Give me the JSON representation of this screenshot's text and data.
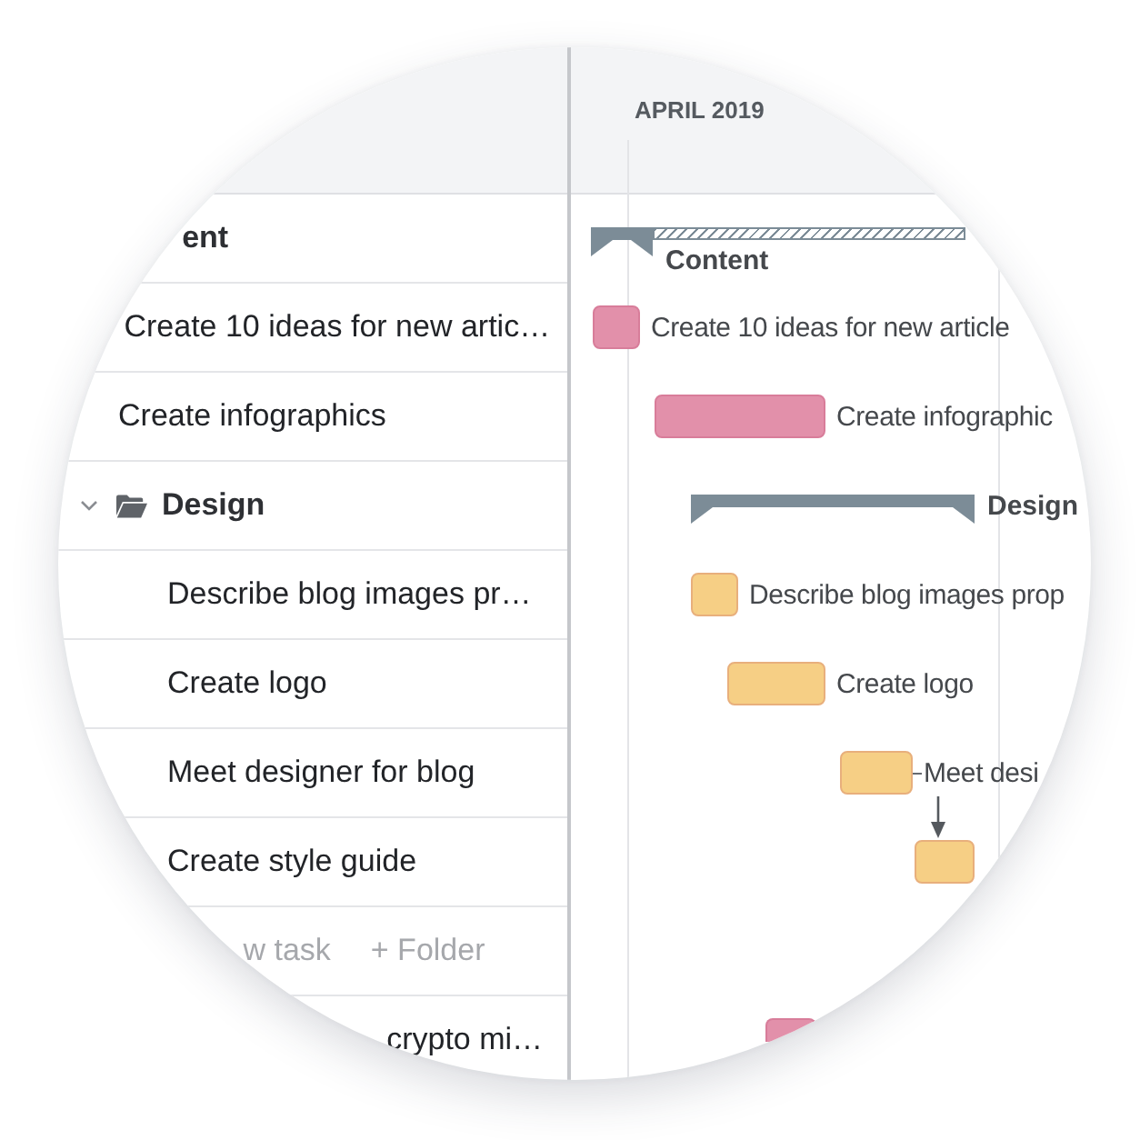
{
  "header": {
    "month": "APRIL 2019"
  },
  "tree": [
    {
      "kind": "group",
      "name": "ent",
      "bar": {
        "label": "Content",
        "striped": true
      },
      "children": [
        {
          "kind": "task",
          "name": "Create 10 ideas for new artic…",
          "bar": {
            "label": "Create 10 ideas for new article",
            "color": "#e290aa",
            "linked_from_previous": false
          }
        },
        {
          "kind": "task",
          "name": "Create infographics",
          "bar": {
            "label": "Create infographic",
            "color": "#e290aa",
            "linked_from_previous": false
          }
        },
        {
          "kind": "group",
          "name": "Design",
          "expanded": true,
          "bar": {
            "label": "Design",
            "striped": false
          },
          "children": [
            {
              "kind": "task",
              "name": "Describe blog images pr…",
              "bar": {
                "label": "Describe blog images prop",
                "color": "#f6cf85",
                "linked_from_previous": false
              }
            },
            {
              "kind": "task",
              "name": "Create logo",
              "bar": {
                "label": "Create logo",
                "color": "#f6cf85",
                "linked_from_previous": false
              }
            },
            {
              "kind": "task",
              "name": "Meet designer for blog",
              "bar": {
                "label": "Meet desi",
                "color": "#f6cf85",
                "linked_from_previous": false
              }
            },
            {
              "kind": "task",
              "name": "Create style guide",
              "bar": {
                "color": "#f6cf85",
                "linked_from_previous": true
              }
            },
            {
              "kind": "add_actions",
              "actions": [
                "w task",
                "+ Folder"
              ]
            }
          ]
        },
        {
          "kind": "task",
          "name": "crypto mi…",
          "bar": {
            "color": "#e290aa"
          }
        }
      ]
    }
  ]
}
